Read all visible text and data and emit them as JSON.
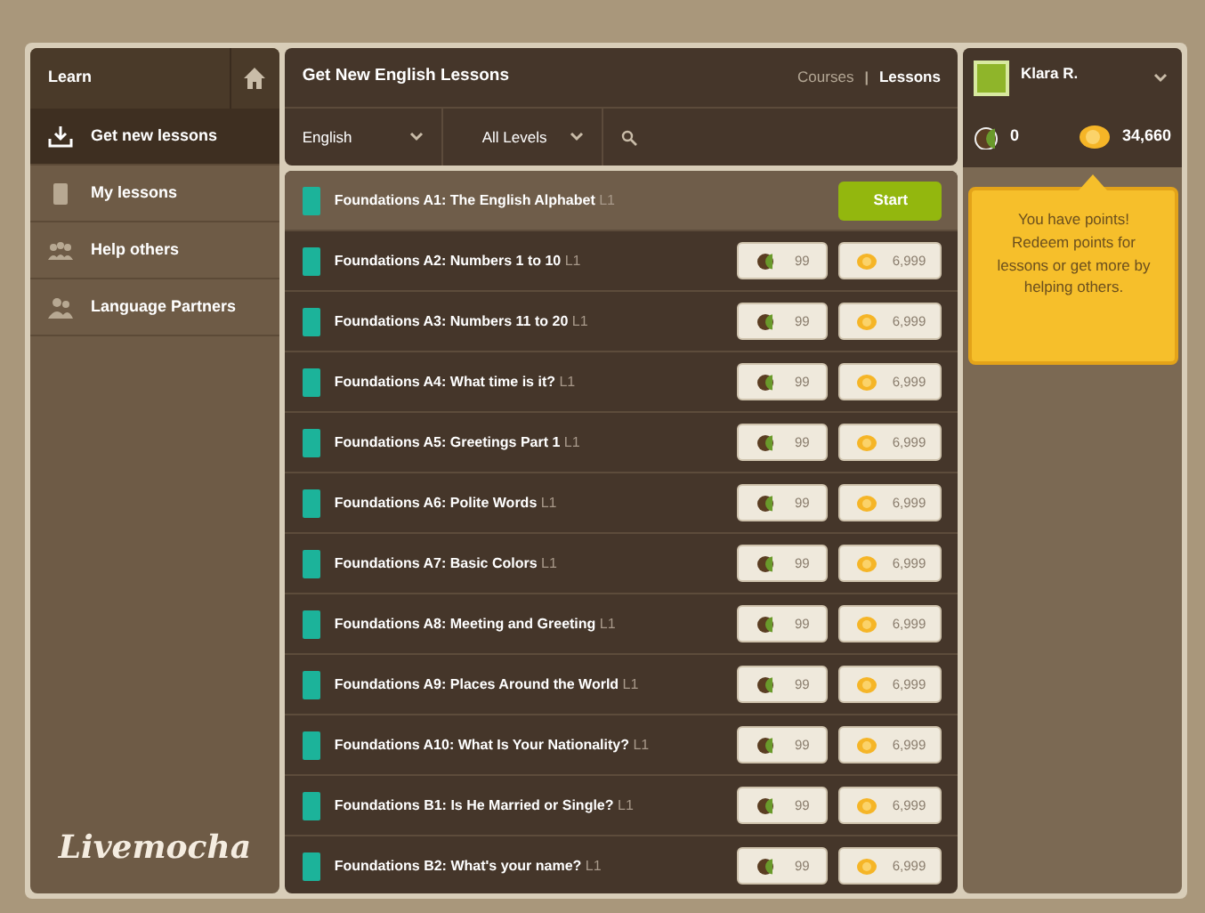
{
  "sidebar": {
    "title": "Learn",
    "items": [
      {
        "label": "Get new lessons",
        "kind": "download",
        "selected": true
      },
      {
        "label": "My lessons",
        "kind": "book",
        "selected": false
      },
      {
        "label": "Help others",
        "kind": "group",
        "selected": false
      },
      {
        "label": "Language Partners",
        "kind": "pair",
        "selected": false
      }
    ],
    "logo": "Livemocha"
  },
  "header": {
    "title": "Get New English Lessons",
    "links": [
      {
        "label": "Courses",
        "selected": false
      },
      {
        "label": "Lessons",
        "selected": true
      }
    ],
    "separator": "|"
  },
  "filters": [
    {
      "value": "English"
    },
    {
      "value": "All Levels"
    }
  ],
  "lessons": [
    {
      "title": "Foundations A1: The English Alphabet",
      "level": "L1",
      "kind": "start",
      "button": "Start"
    },
    {
      "title": "Foundations A2: Numbers 1 to 10",
      "level": "L1",
      "kind": "price",
      "apples": "99",
      "coins": "6,999"
    },
    {
      "title": "Foundations A3: Numbers 11 to 20",
      "level": "L1",
      "kind": "price",
      "apples": "99",
      "coins": "6,999"
    },
    {
      "title": "Foundations A4: What time is it?",
      "level": "L1",
      "kind": "price",
      "apples": "99",
      "coins": "6,999"
    },
    {
      "title": "Foundations A5: Greetings Part 1",
      "level": "L1",
      "kind": "price",
      "apples": "99",
      "coins": "6,999"
    },
    {
      "title": "Foundations A6: Polite Words",
      "level": "L1",
      "kind": "price",
      "apples": "99",
      "coins": "6,999"
    },
    {
      "title": "Foundations A7: Basic Colors",
      "level": "L1",
      "kind": "price",
      "apples": "99",
      "coins": "6,999"
    },
    {
      "title": "Foundations A8: Meeting and Greeting",
      "level": "L1",
      "kind": "price",
      "apples": "99",
      "coins": "6,999"
    },
    {
      "title": "Foundations A9: Places Around the World",
      "level": "L1",
      "kind": "price",
      "apples": "99",
      "coins": "6,999"
    },
    {
      "title": "Foundations A10: What Is Your Nationality?",
      "level": "L1",
      "kind": "price",
      "apples": "99",
      "coins": "6,999"
    },
    {
      "title": "Foundations B1: Is He Married or Single?",
      "level": "L1",
      "kind": "price",
      "apples": "99",
      "coins": "6,999"
    },
    {
      "title": "Foundations B2: What's your name?",
      "level": "L1",
      "kind": "price",
      "apples": "99",
      "coins": "6,999"
    }
  ],
  "user": {
    "name": "Klara R.",
    "apples": "0",
    "coins": "34,660"
  },
  "tooltip": "You have points! Redeem points for lessons or get more by helping others."
}
